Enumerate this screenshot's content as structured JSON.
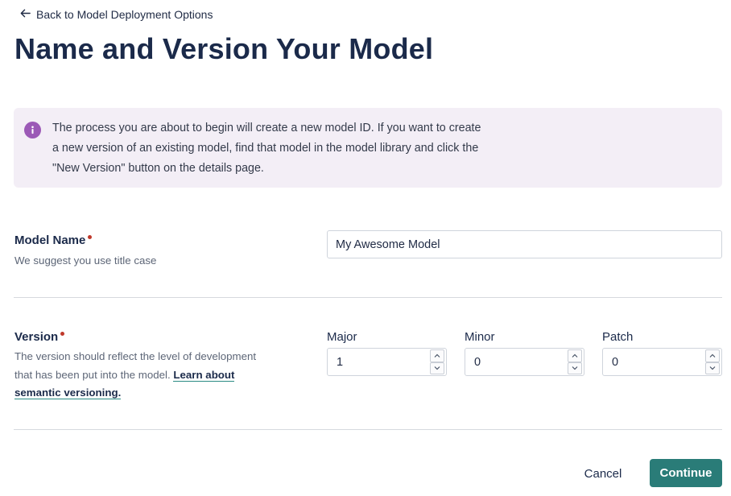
{
  "nav": {
    "back_label": "Back to Model Deployment Options"
  },
  "page": {
    "title": "Name and Version Your Model"
  },
  "info": {
    "line1": "The process you are about to begin will create a new model ID. If you want to create",
    "line2": "a new version of an existing model, find that model in the model library and click the",
    "line3": "\"New Version\" button on the details page."
  },
  "model_name": {
    "label": "Model Name",
    "help": "We suggest you use title case",
    "value": "My Awesome Model"
  },
  "version": {
    "label": "Version",
    "help_line1": "The version should reflect the level of development",
    "help_line2_prefix": "that has been put into the model. ",
    "help_link_part1": "Learn about",
    "help_link_part2": "semantic versioning",
    "help_suffix": ".",
    "major": {
      "label": "Major",
      "value": "1"
    },
    "minor": {
      "label": "Minor",
      "value": "0"
    },
    "patch": {
      "label": "Patch",
      "value": "0"
    }
  },
  "actions": {
    "cancel_label": "Cancel",
    "continue_label": "Continue"
  },
  "colors": {
    "accent": "#2a7c78",
    "info_bg": "#f3eef6",
    "info_icon": "#9b59b6",
    "required": "#c0392b"
  }
}
